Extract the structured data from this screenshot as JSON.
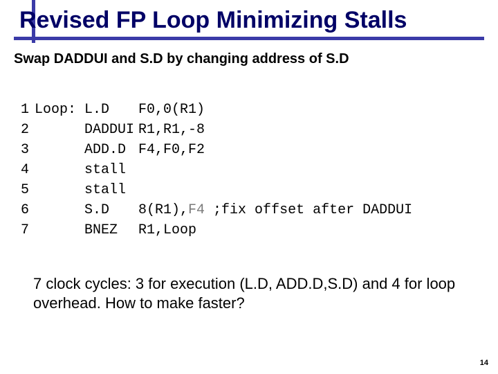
{
  "title": "Revised FP Loop Minimizing Stalls",
  "subhead": "Swap DADDUI and S.D by changing address of S.D",
  "code": {
    "lines": [
      {
        "n": "1",
        "label": "Loop:",
        "mn": "L.D",
        "args": "F0,0(R1)"
      },
      {
        "n": "2",
        "label": "",
        "mn": "DADDUI",
        "args": "R1,R1,-8"
      },
      {
        "n": "3",
        "label": "",
        "mn": "ADD.D",
        "args": "F4,F0,F2"
      },
      {
        "n": "4",
        "label": "",
        "mn": "stall",
        "args": ""
      },
      {
        "n": "5",
        "label": "",
        "mn": "stall",
        "args": ""
      },
      {
        "n": "6",
        "label": "",
        "mn": "S.D",
        "args_pre": "8(R1),",
        "args_gray": "F4",
        "args_post": " ;fix offset after DADDUI"
      },
      {
        "n": "7",
        "label": "",
        "mn": "BNEZ",
        "args": "R1,Loop"
      }
    ]
  },
  "footer": "7 clock cycles:  3 for execution (L.D, ADD.D,S.D) and  4 for loop overhead. How to make  faster?",
  "page_number": "14"
}
